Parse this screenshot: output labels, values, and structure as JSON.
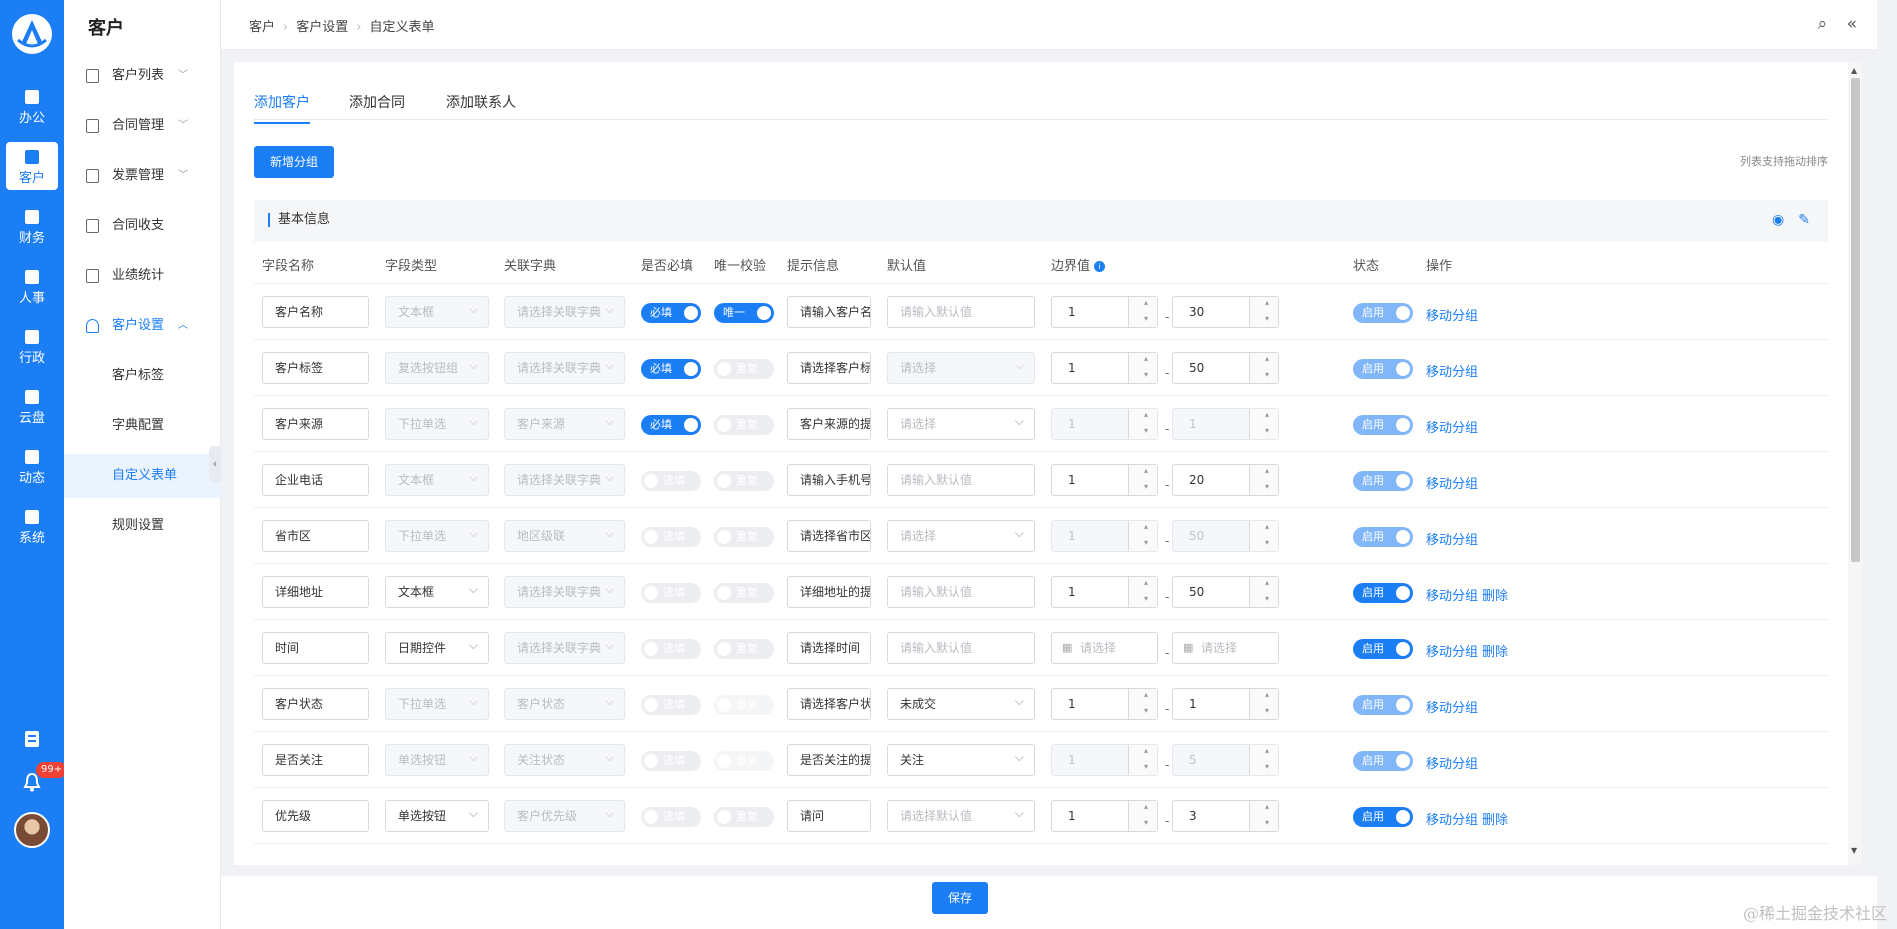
{
  "rail": {
    "items": [
      {
        "label": "办公",
        "icon": "briefcase-icon"
      },
      {
        "label": "客户",
        "icon": "user-icon"
      },
      {
        "label": "财务",
        "icon": "money-icon"
      },
      {
        "label": "人事",
        "icon": "id-card-icon"
      },
      {
        "label": "行政",
        "icon": "building-icon"
      },
      {
        "label": "云盘",
        "icon": "cloud-icon"
      },
      {
        "label": "动态",
        "icon": "feed-icon"
      },
      {
        "label": "系统",
        "icon": "settings-icon"
      }
    ],
    "notif_badge": "99+",
    "accent": "#1b7ef5"
  },
  "sidebar": {
    "title": "客户",
    "items": [
      {
        "label": "客户列表"
      },
      {
        "label": "合同管理"
      },
      {
        "label": "发票管理"
      },
      {
        "label": "合同收支"
      },
      {
        "label": "业绩统计"
      },
      {
        "label": "客户设置"
      },
      {
        "label": "客户标签"
      },
      {
        "label": "字典配置"
      },
      {
        "label": "自定义表单"
      },
      {
        "label": "规则设置"
      }
    ]
  },
  "breadcrumb": [
    "客户",
    "客户设置",
    "自定义表单"
  ],
  "tabs": [
    "添加客户",
    "添加合同",
    "添加联系人"
  ],
  "add_group_label": "新增分组",
  "sort_hint": "列表支持拖动排序",
  "group": {
    "title": "基本信息",
    "columns": [
      "字段名称",
      "字段类型",
      "关联字典",
      "是否必填",
      "唯一校验",
      "提示信息",
      "默认值",
      "边界值",
      "状态",
      "操作"
    ],
    "rows": [
      {
        "name": "客户名称",
        "type": "文本框",
        "type_dis": true,
        "dict": "请选择关联字典",
        "required": "必填",
        "req_on": true,
        "unique": "唯一",
        "uniq_on": true,
        "uniq_dis": false,
        "tip": "请输入客户名",
        "def": "请输入默认值",
        "def_ph": true,
        "def_sel": false,
        "def_dis": false,
        "min": "1",
        "max": "30",
        "bound_dis": false,
        "status": "启用",
        "status_dis": true,
        "move": "移动分组",
        "delete": ""
      },
      {
        "name": "客户标签",
        "type": "复选按钮组",
        "type_dis": true,
        "dict": "请选择关联字典",
        "required": "必填",
        "req_on": true,
        "unique": "重复",
        "uniq_on": false,
        "uniq_dis": true,
        "tip": "请选择客户标",
        "def": "请选择",
        "def_ph": true,
        "def_sel": true,
        "def_dis": true,
        "min": "1",
        "max": "50",
        "bound_dis": false,
        "status": "启用",
        "status_dis": true,
        "move": "移动分组",
        "delete": ""
      },
      {
        "name": "客户来源",
        "type": "下拉单选",
        "type_dis": true,
        "dict": "客户来源",
        "required": "必填",
        "req_on": true,
        "unique": "重复",
        "uniq_on": false,
        "uniq_dis": true,
        "tip": "客户来源的提",
        "def": "请选择",
        "def_ph": true,
        "def_sel": true,
        "def_dis": false,
        "min": "1",
        "max": "1",
        "bound_dis": true,
        "status": "启用",
        "status_dis": true,
        "move": "移动分组",
        "delete": ""
      },
      {
        "name": "企业电话",
        "type": "文本框",
        "type_dis": true,
        "dict": "请选择关联字典",
        "required": "选填",
        "req_on": false,
        "unique": "重复",
        "uniq_on": false,
        "uniq_dis": true,
        "tip": "请输入手机号",
        "def": "请输入默认值",
        "def_ph": true,
        "def_sel": false,
        "def_dis": false,
        "min": "1",
        "max": "20",
        "bound_dis": false,
        "status": "启用",
        "status_dis": true,
        "move": "移动分组",
        "delete": ""
      },
      {
        "name": "省市区",
        "type": "下拉单选",
        "type_dis": true,
        "dict": "地区级联",
        "required": "选填",
        "req_on": false,
        "unique": "重复",
        "uniq_on": false,
        "uniq_dis": true,
        "tip": "请选择省市区",
        "def": "请选择",
        "def_ph": true,
        "def_sel": true,
        "def_dis": false,
        "min": "1",
        "max": "50",
        "bound_dis": true,
        "status": "启用",
        "status_dis": true,
        "move": "移动分组",
        "delete": ""
      },
      {
        "name": "详细地址",
        "type": "文本框",
        "type_dis": false,
        "dict": "请选择关联字典",
        "required": "选填",
        "req_on": false,
        "unique": "重复",
        "uniq_on": false,
        "uniq_dis": true,
        "tip": "详细地址的提",
        "def": "请输入默认值",
        "def_ph": true,
        "def_sel": false,
        "def_dis": false,
        "min": "1",
        "max": "50",
        "bound_dis": false,
        "status": "启用",
        "status_dis": false,
        "move": "移动分组",
        "delete": "删除"
      },
      {
        "name": "时间",
        "type": "日期控件",
        "type_dis": false,
        "dict": "请选择关联字典",
        "required": "选填",
        "req_on": false,
        "unique": "重复",
        "uniq_on": false,
        "uniq_dis": true,
        "tip": "请选择时间",
        "def": "请输入默认值",
        "def_ph": true,
        "def_sel": false,
        "def_dis": false,
        "min": "请选择",
        "max": "请选择",
        "bound_date": true,
        "bound_dis": false,
        "status": "启用",
        "status_dis": false,
        "move": "移动分组",
        "delete": "删除"
      },
      {
        "name": "客户状态",
        "type": "下拉单选",
        "type_dis": true,
        "dict": "客户状态",
        "required": "选填",
        "req_on": false,
        "unique": "重复",
        "uniq_on": false,
        "uniq_dis": true,
        "uniq_faint": true,
        "tip": "请选择客户状",
        "def": "未成交",
        "def_ph": false,
        "def_sel": true,
        "def_dis": false,
        "min": "1",
        "max": "1",
        "bound_dis": false,
        "status": "启用",
        "status_dis": true,
        "move": "移动分组",
        "delete": ""
      },
      {
        "name": "是否关注",
        "type": "单选按钮",
        "type_dis": true,
        "dict": "关注状态",
        "required": "选填",
        "req_on": false,
        "unique": "重复",
        "uniq_on": false,
        "uniq_dis": true,
        "uniq_faint": true,
        "tip": "是否关注的提",
        "def": "关注",
        "def_ph": false,
        "def_sel": true,
        "def_dis": false,
        "min": "1",
        "max": "5",
        "bound_dis": true,
        "status": "启用",
        "status_dis": true,
        "move": "移动分组",
        "delete": ""
      },
      {
        "name": "优先级",
        "type": "单选按钮",
        "type_dis": false,
        "dict": "客户优先级",
        "dict_active": true,
        "required": "选填",
        "req_on": false,
        "unique": "重复",
        "uniq_on": false,
        "uniq_dis": true,
        "tip": "请问",
        "def": "请选择默认值",
        "def_ph": true,
        "def_sel": true,
        "def_dis": false,
        "min": "1",
        "max": "3",
        "bound_dis": false,
        "status": "启用",
        "status_dis": false,
        "move": "移动分组",
        "delete": "删除"
      }
    ]
  },
  "save_label": "保存",
  "watermark": "@稀土掘金技术社区"
}
